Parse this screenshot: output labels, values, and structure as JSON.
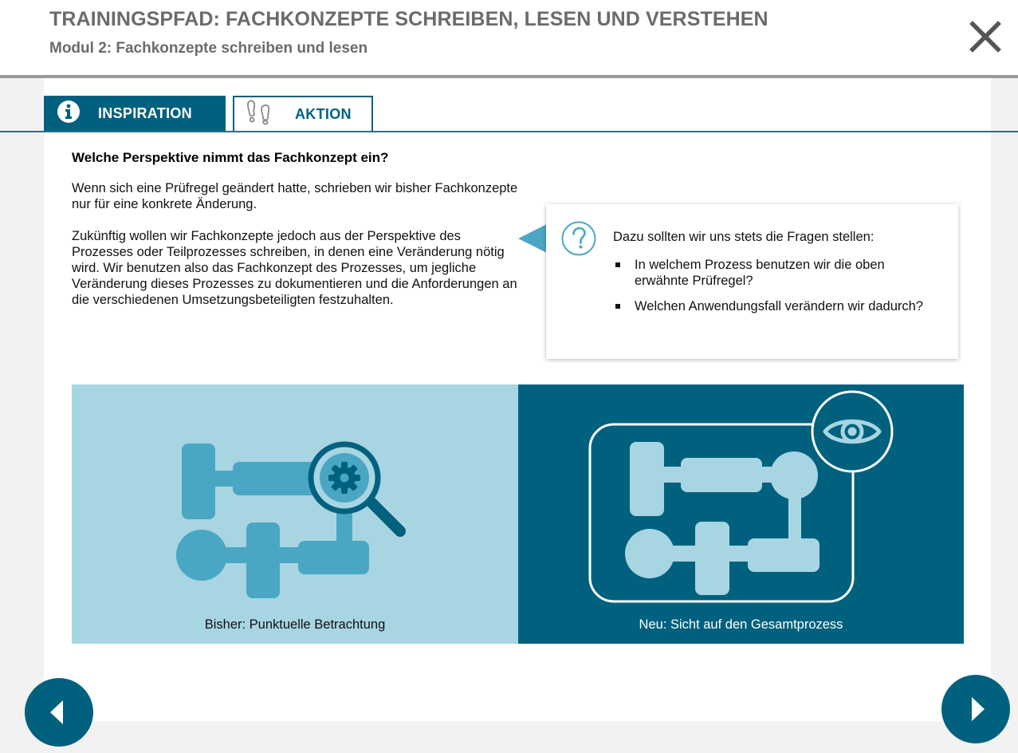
{
  "header": {
    "course_title": "TRAININGSPFAD: FACHKONZEPTE SCHREIBEN, LESEN UND VERSTEHEN",
    "module_title": "Modul 2: Fachkonzepte schreiben und lesen",
    "close_icon": "close-icon"
  },
  "tabs": [
    {
      "label": "INSPIRATION",
      "icon": "info-icon",
      "active": true
    },
    {
      "label": "AKTION",
      "icon": "footprints-icon",
      "active": false
    }
  ],
  "main": {
    "heading": "Welche Perspektive nimmt das Fachkonzept ein?",
    "paragraph_1": "Wenn sich eine Prüfregel geändert hatte, schrieben wir bisher Fachkonzepte nur für eine konkrete Änderung.",
    "paragraph_2": "Zukünftig wollen wir Fachkonzepte jedoch aus der Perspektive des Prozesses oder Teilprozesses schreiben, in denen eine Veränderung nötig wird. Wir benutzen also das Fachkonzept des Prozesses, um jegliche Veränderung dieses Prozesses zu dokumentieren und die Anforderungen an die verschiedenen Umsetzungsbeteiligten festzuhalten."
  },
  "callout": {
    "icon": "question-icon",
    "intro": "Dazu sollten wir uns stets die Fragen stellen:",
    "items": [
      "In welchem Prozess benutzen wir die oben erwähnte Prüfregel?",
      "Welchen Anwendungsfall verändern wir dadurch?"
    ]
  },
  "illustrations": {
    "left": {
      "caption": "Bisher: Punktuelle Betrachtung",
      "icon": "process-magnifier-icon"
    },
    "right": {
      "caption": "Neu: Sicht auf den Gesamtprozess",
      "icon": "process-overview-eye-icon"
    }
  },
  "navigation": {
    "prev_icon": "arrow-left-icon",
    "next_icon": "arrow-right-icon"
  },
  "colors": {
    "primary": "#00617f",
    "accent_light": "#a8d5e2",
    "accent_mid": "#4aa7c4",
    "header_text": "#6b6b6b"
  }
}
